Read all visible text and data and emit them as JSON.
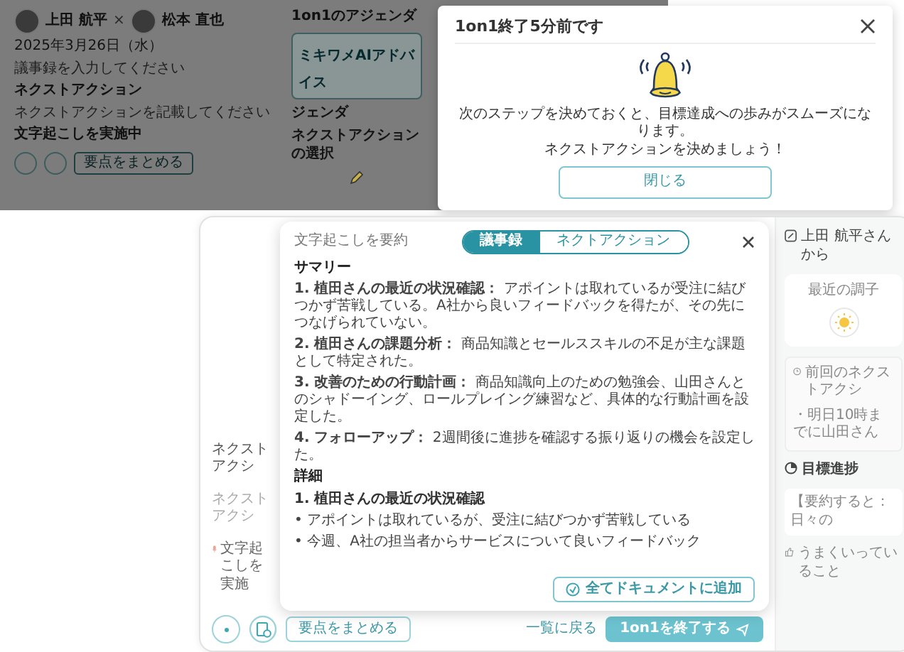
{
  "back_window": {
    "participants": [
      {
        "name": "上田 航平"
      },
      {
        "name": "松本 直也"
      }
    ],
    "separator": "×",
    "date": "2025年3月26日（水）",
    "minutes_placeholder": "議事録を入力してください",
    "next_action": {
      "label": "ネクストアクション",
      "placeholder": "ネクストアクションを記載してください"
    },
    "transcription_status": "文字起こしを実施中",
    "summarize_button": "要点をまとめる",
    "agenda": {
      "title": "1on1のアジェンダ",
      "ai_advice": "ミキワメAIアドバイス",
      "section": "ジェンダ",
      "next_action_choice": "ネクストアクションの選択"
    }
  },
  "modal": {
    "title": "1on1終了5分前です",
    "message": [
      "次のステップを決めておくと、目標達成への歩みがスムーズになります。",
      "ネクストアクションを決めましょう！"
    ],
    "close_button": "閉じる"
  },
  "front_window": {
    "next_action": {
      "label": "ネクストアクシ",
      "placeholder": "ネクストアクシ"
    },
    "transcription_status": "文字起こしを実施",
    "summary_popup": {
      "title": "文字起こしを要約",
      "tabs": [
        {
          "label": "議事録",
          "selected": true
        },
        {
          "label": "ネクトアクション",
          "selected": false
        }
      ],
      "heading": "サマリー",
      "items": [
        "**1. 植田さんの最近の状況確認：** アポイントは取れているが受注に結びつかず苦戦している。A社から良いフィードバックを得たが、その先につなげられていない。",
        "**2. 植田さんの課題分析：** 商品知識とセールススキルの不足が主な課題として特定された。",
        "**3. 改善のための行動計画：** 商品知識向上のための勉強会、山田さんとのシャドーイング、ロールプレイング練習など、具体的な行動計画を設定した。",
        "**4. フォローアップ：** 2週間後に進捗を確認する振り返りの機会を設定した。"
      ],
      "details_heading": "詳細",
      "detail_title": "1. 植田さんの最近の状況確認",
      "detail_bullets": [
        "• アポイントは取れているが、受注に結びつかず苦戦している",
        "• 今週、A社の担当者からサービスについて良いフィードバック"
      ],
      "add_button": "全てドキュメントに追加"
    },
    "bottom_bar": {
      "summarize_button": "要点をまとめる",
      "back_link": "一覧に戻る",
      "end_button": "1on1を終了する"
    },
    "side_panel": {
      "header": "上田 航平さんから",
      "mood_label": "最近の調子",
      "previous_action_label": "前回のネクストアクシ",
      "previous_action_item": "・明日10時までに山田さん",
      "goal_progress": "目標進捗",
      "goal_summary": "【要約すると：日々の",
      "going_well": "うまくいっていること"
    }
  }
}
